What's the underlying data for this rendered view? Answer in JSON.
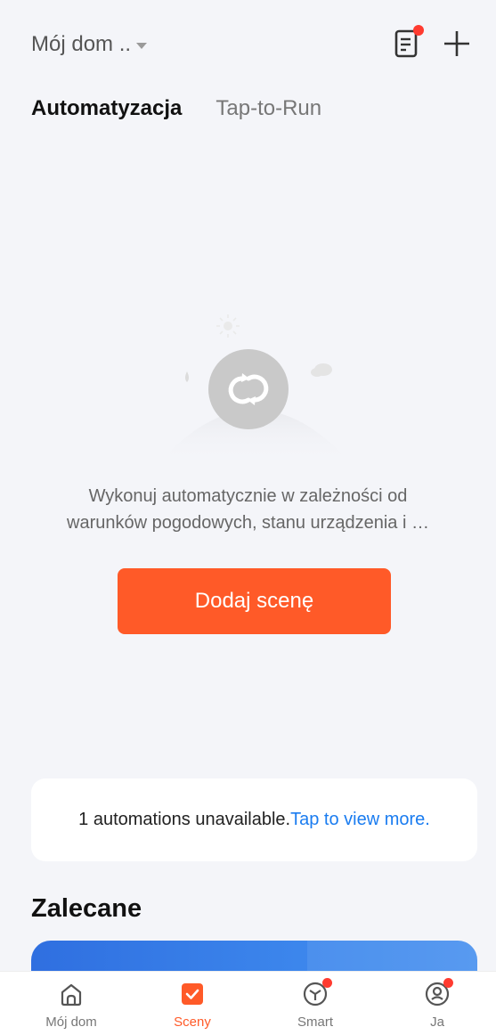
{
  "header": {
    "home_label": "Mój dom ..",
    "doc_icon": "document-icon",
    "plus_icon": "plus-icon"
  },
  "tabs": [
    {
      "label": "Automatyzacja",
      "active": true
    },
    {
      "label": "Tap-to-Run",
      "active": false
    }
  ],
  "empty_state": {
    "icon": "automation-loop-icon",
    "text_line1": "Wykonuj automatycznie w zależności od",
    "text_line2": "warunków pogodowych, stanu urządzenia i …",
    "button_label": "Dodaj scenę"
  },
  "notice": {
    "text": "1 automations unavailable.",
    "link": "Tap to view more."
  },
  "recommended": {
    "title": "Zalecane"
  },
  "bottom_nav": [
    {
      "label": "Mój dom",
      "icon": "home-icon"
    },
    {
      "label": "Sceny",
      "icon": "check-square-icon",
      "active": true
    },
    {
      "label": "Smart",
      "icon": "cube-icon"
    },
    {
      "label": "Ja",
      "icon": "profile-icon"
    }
  ],
  "colors": {
    "accent": "#ff5a28",
    "link": "#1a7cf0",
    "badge": "#ff3b30",
    "background": "#f4f5f9"
  }
}
